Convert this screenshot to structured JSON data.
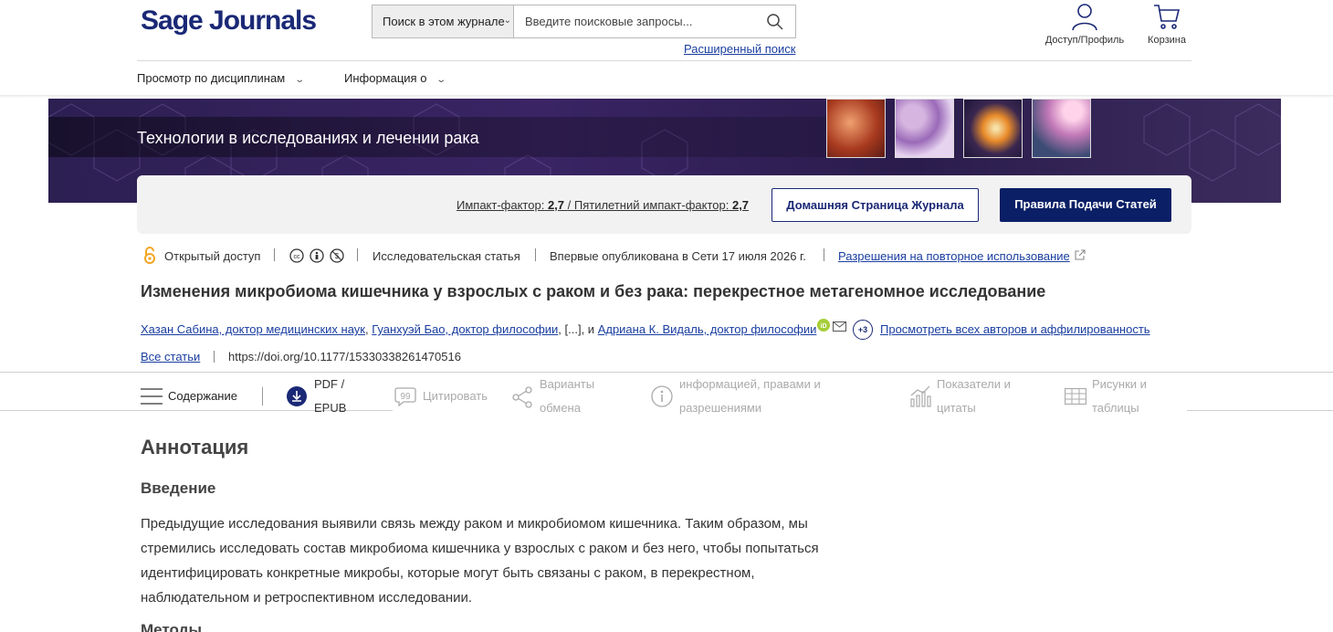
{
  "header": {
    "logo_text": "Sage Journals",
    "search_scope": "Поиск в этом журнале",
    "search_placeholder": "Введите поисковые запросы...",
    "advanced_search": "Расширенный поиск",
    "access_label": "Доступ/Профиль",
    "cart_label": "Корзина"
  },
  "nav": {
    "browse": "Просмотр по дисциплинам",
    "about": "Информация о"
  },
  "banner": {
    "journal_title": "Технологии в исследованиях и лечении рака"
  },
  "impact": {
    "impact_label": "Импакт-фактор:",
    "impact_value": "2,7",
    "five_year_label": "/ Пятилетний импакт-фактор:",
    "five_year_value": "2,7",
    "home_button": "Домашняя Страница Журнала",
    "submit_button": "Правила Подачи Статей"
  },
  "meta": {
    "open_access": "Открытый доступ",
    "article_type": "Исследовательская статья",
    "published": "Впервые опубликована в Сети 17 июля 2026 г.",
    "permissions": "Разрешения на повторное использование"
  },
  "article": {
    "title": "Изменения микробиома кишечника у взрослых с раком и без рака: перекрестное метагеномное исследование",
    "author1": "Хазан Сабина, доктор медицинских наук",
    "author2": "Гуанхуэй Бао, доктор философии",
    "ellipsis": ", [...], и ",
    "author3": "Адриана К. Видаль, доктор философии",
    "more_count": "+3",
    "all_authors": "Просмотреть всех авторов и аффилированность",
    "all_articles": "Все статьи",
    "doi": "https://doi.org/10.1177/15330338261470516"
  },
  "toolbar": {
    "contents": "Содержание",
    "pdf": "PDF / EPUB",
    "cite": "Цитировать",
    "share": "Варианты обмена",
    "info": "информацией, правами и разрешениями",
    "metrics": "Показатели и цитаты",
    "figures": "Рисунки и таблицы"
  },
  "abstract": {
    "heading": "Аннотация",
    "intro_heading": "Введение",
    "intro_text": "Предыдущие исследования выявили связь между раком и микробиомом кишечника. Таким образом, мы стремились исследовать состав микробиома кишечника у взрослых с раком и без него, чтобы попытаться идентифицировать конкретные микробы, которые могут быть связаны с раком, в перекрестном, наблюдательном и ретроспективном исследовании.",
    "methods_heading": "Методы"
  },
  "colors": {
    "brand_navy": "#1a2876",
    "link_blue": "#1a3ea0",
    "oa_orange": "#f5a623",
    "orcid_green": "#a6ce39"
  }
}
